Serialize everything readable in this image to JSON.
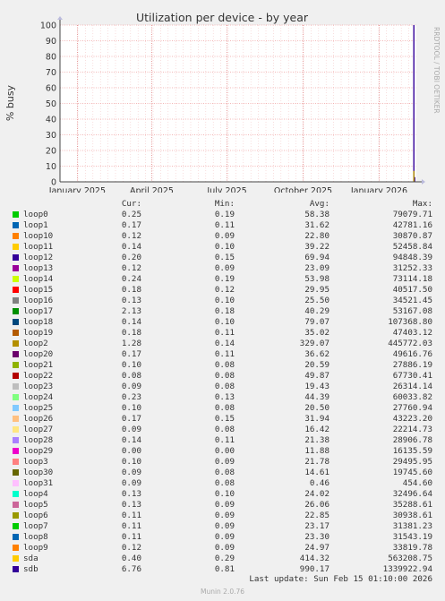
{
  "title": "Utilization per device - by year",
  "side_label": "RRDTOOL / TOBI OETIKER",
  "watermark": "Munin 2.0.76",
  "last_update": "Last update: Sun Feb 15 01:10:00 2026",
  "columns": {
    "cur": "Cur:",
    "min": "Min:",
    "avg": "Avg:",
    "max": "Max:"
  },
  "chart_data": {
    "type": "line",
    "title": "Utilization per device - by year",
    "ylabel": "% busy",
    "ylim": [
      0,
      100
    ],
    "yticks": [
      0,
      10,
      20,
      30,
      40,
      50,
      60,
      70,
      80,
      90,
      100
    ],
    "xticks": [
      {
        "label": "January 2025",
        "date": "2025-01-01"
      },
      {
        "label": "April 2025",
        "date": "2025-04-01"
      },
      {
        "label": "July 2025",
        "date": "2025-07-01"
      },
      {
        "label": "October 2025",
        "date": "2025-10-01"
      },
      {
        "label": "January 2026",
        "date": "2026-01-01"
      }
    ],
    "xrange": [
      "2024-12-11",
      "2026-02-15"
    ],
    "grid": true,
    "spike_series": [
      {
        "name": "sdb",
        "values": [
          {
            "date": "2026-02-12",
            "value": 100
          },
          {
            "date": "2026-02-13",
            "value": 3
          }
        ]
      },
      {
        "name": "loop2",
        "values": [
          {
            "date": "2026-02-12",
            "value": 7
          }
        ]
      }
    ],
    "series": [
      {
        "name": "loop0",
        "color": "#00cc00",
        "cur": "0.25",
        "min": "0.19",
        "avg": "58.38",
        "max": "79079.71"
      },
      {
        "name": "loop1",
        "color": "#0066b3",
        "cur": "0.17",
        "min": "0.11",
        "avg": "31.62",
        "max": "42781.16"
      },
      {
        "name": "loop10",
        "color": "#ff8000",
        "cur": "0.12",
        "min": "0.09",
        "avg": "22.80",
        "max": "30870.87"
      },
      {
        "name": "loop11",
        "color": "#ffcc00",
        "cur": "0.14",
        "min": "0.10",
        "avg": "39.22",
        "max": "52458.84"
      },
      {
        "name": "loop12",
        "color": "#330099",
        "cur": "0.20",
        "min": "0.15",
        "avg": "69.94",
        "max": "94848.39"
      },
      {
        "name": "loop13",
        "color": "#990099",
        "cur": "0.12",
        "min": "0.09",
        "avg": "23.09",
        "max": "31252.33"
      },
      {
        "name": "loop14",
        "color": "#ccff00",
        "cur": "0.24",
        "min": "0.19",
        "avg": "53.98",
        "max": "73114.18"
      },
      {
        "name": "loop15",
        "color": "#ff0000",
        "cur": "0.18",
        "min": "0.12",
        "avg": "29.95",
        "max": "40517.50"
      },
      {
        "name": "loop16",
        "color": "#808080",
        "cur": "0.13",
        "min": "0.10",
        "avg": "25.50",
        "max": "34521.45"
      },
      {
        "name": "loop17",
        "color": "#008f00",
        "cur": "2.13",
        "min": "0.18",
        "avg": "40.29",
        "max": "53167.08"
      },
      {
        "name": "loop18",
        "color": "#00487d",
        "cur": "0.14",
        "min": "0.10",
        "avg": "79.07",
        "max": "107368.80"
      },
      {
        "name": "loop19",
        "color": "#b35a00",
        "cur": "0.18",
        "min": "0.11",
        "avg": "35.02",
        "max": "47403.12"
      },
      {
        "name": "loop2",
        "color": "#b38f00",
        "cur": "1.28",
        "min": "0.14",
        "avg": "329.07",
        "max": "445772.03"
      },
      {
        "name": "loop20",
        "color": "#6b006b",
        "cur": "0.17",
        "min": "0.11",
        "avg": "36.62",
        "max": "49616.76"
      },
      {
        "name": "loop21",
        "color": "#8fb300",
        "cur": "0.10",
        "min": "0.08",
        "avg": "20.59",
        "max": "27886.19"
      },
      {
        "name": "loop22",
        "color": "#b30000",
        "cur": "0.08",
        "min": "0.08",
        "avg": "49.87",
        "max": "67730.41"
      },
      {
        "name": "loop23",
        "color": "#bebebe",
        "cur": "0.09",
        "min": "0.08",
        "avg": "19.43",
        "max": "26314.14"
      },
      {
        "name": "loop24",
        "color": "#80ff80",
        "cur": "0.23",
        "min": "0.13",
        "avg": "44.39",
        "max": "60033.82"
      },
      {
        "name": "loop25",
        "color": "#80c9ff",
        "cur": "0.10",
        "min": "0.08",
        "avg": "20.50",
        "max": "27760.94"
      },
      {
        "name": "loop26",
        "color": "#ffc080",
        "cur": "0.17",
        "min": "0.15",
        "avg": "31.94",
        "max": "43223.20"
      },
      {
        "name": "loop27",
        "color": "#ffe680",
        "cur": "0.09",
        "min": "0.08",
        "avg": "16.42",
        "max": "22214.73"
      },
      {
        "name": "loop28",
        "color": "#aa80ff",
        "cur": "0.14",
        "min": "0.11",
        "avg": "21.38",
        "max": "28906.78"
      },
      {
        "name": "loop29",
        "color": "#ee00cc",
        "cur": "0.00",
        "min": "0.00",
        "avg": "11.88",
        "max": "16135.59"
      },
      {
        "name": "loop3",
        "color": "#ff8080",
        "cur": "0.10",
        "min": "0.09",
        "avg": "21.78",
        "max": "29495.95"
      },
      {
        "name": "loop30",
        "color": "#666600",
        "cur": "0.09",
        "min": "0.08",
        "avg": "14.61",
        "max": "19745.60"
      },
      {
        "name": "loop31",
        "color": "#ffbfff",
        "cur": "0.09",
        "min": "0.08",
        "avg": "0.46",
        "max": "454.60"
      },
      {
        "name": "loop4",
        "color": "#00ffcc",
        "cur": "0.13",
        "min": "0.10",
        "avg": "24.02",
        "max": "32496.64"
      },
      {
        "name": "loop5",
        "color": "#cc6699",
        "cur": "0.13",
        "min": "0.09",
        "avg": "26.06",
        "max": "35288.61"
      },
      {
        "name": "loop6",
        "color": "#999900",
        "cur": "0.11",
        "min": "0.09",
        "avg": "22.85",
        "max": "30938.61"
      },
      {
        "name": "loop7",
        "color": "#00cc00",
        "cur": "0.11",
        "min": "0.09",
        "avg": "23.17",
        "max": "31381.23"
      },
      {
        "name": "loop8",
        "color": "#0066b3",
        "cur": "0.11",
        "min": "0.09",
        "avg": "23.30",
        "max": "31543.19"
      },
      {
        "name": "loop9",
        "color": "#ff8000",
        "cur": "0.12",
        "min": "0.09",
        "avg": "24.97",
        "max": "33819.78"
      },
      {
        "name": "sda",
        "color": "#ffcc00",
        "cur": "0.40",
        "min": "0.29",
        "avg": "414.32",
        "max": "563208.75"
      },
      {
        "name": "sdb",
        "color": "#330099",
        "cur": "6.76",
        "min": "0.81",
        "avg": "990.17",
        "max": "1339922.94"
      }
    ]
  }
}
